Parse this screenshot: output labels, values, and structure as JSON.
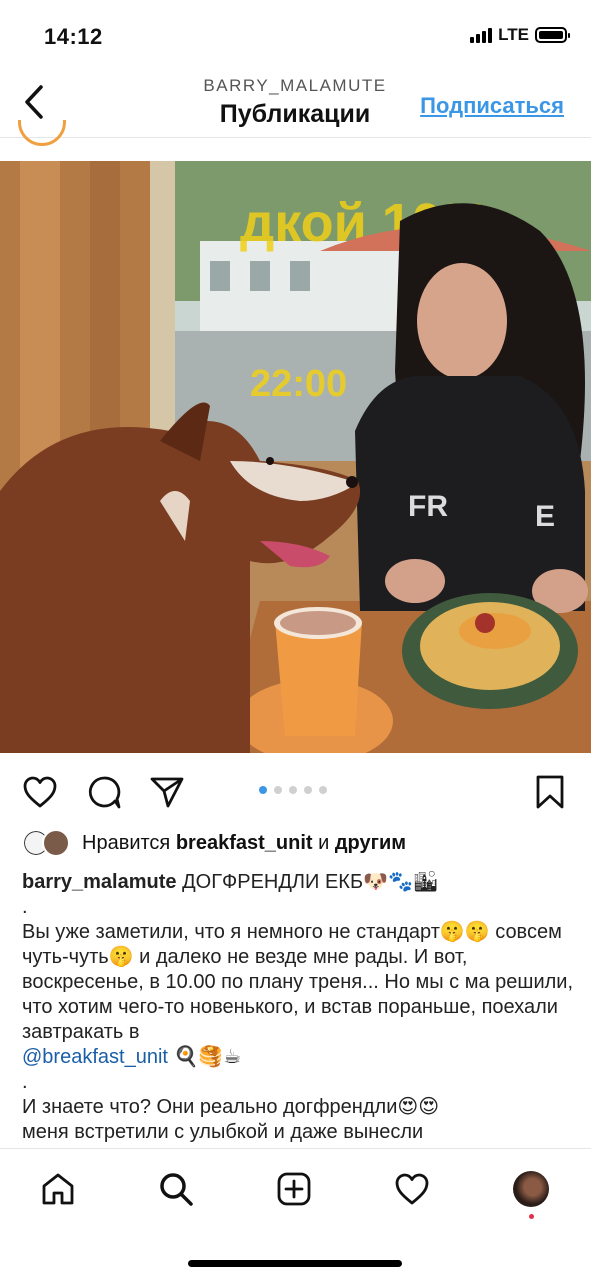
{
  "status_bar": {
    "time": "14:12",
    "network": "LTE",
    "battery_level": 1.0
  },
  "header": {
    "username": "BARRY_MALAMUTE",
    "title": "Публикации",
    "follow_label": "Подписаться",
    "back_icon": "chevron-left-icon"
  },
  "post": {
    "image_description_icon": "photo",
    "carousel": {
      "count": 5,
      "active_index": 0
    },
    "actions": [
      "heart-icon",
      "comment-icon",
      "share-icon",
      "bookmark-icon"
    ],
    "likes": {
      "prefix": "Нравится",
      "user": "breakfast_unit",
      "middle": "и",
      "suffix": "другим"
    },
    "caption": {
      "username": "barry_malamute",
      "title_text": "ДОГФРЕНДЛИ ЕКБ🐶🐾🏙",
      "dot1": ".",
      "paragraph1": "Вы уже заметили, что я немного не стандарт🤫🤫 совсем чуть-чуть🤫 и далеко не везде мне рады. И вот, воскресенье, в 10.00 по плану треня... Но мы с ма решили, что хотим чего-то новенького, и встав пораньше, поехали завтракать в",
      "mention": "@breakfast_unit",
      "mention_emoji": "🍳🥞☕",
      "dot2": ".",
      "paragraph2": "И знаете что? Они реально догфрендли😍😍",
      "paragraph3": "меня встретили с улыбкой и даже вынесли"
    }
  },
  "tab_bar": {
    "items": [
      "home-icon",
      "search-icon",
      "add-icon",
      "activity-icon",
      "profile-avatar"
    ]
  },
  "colors": {
    "accent": "#3c96e6",
    "mention": "#1a5ea8",
    "notification_dot": "#e0304a"
  }
}
